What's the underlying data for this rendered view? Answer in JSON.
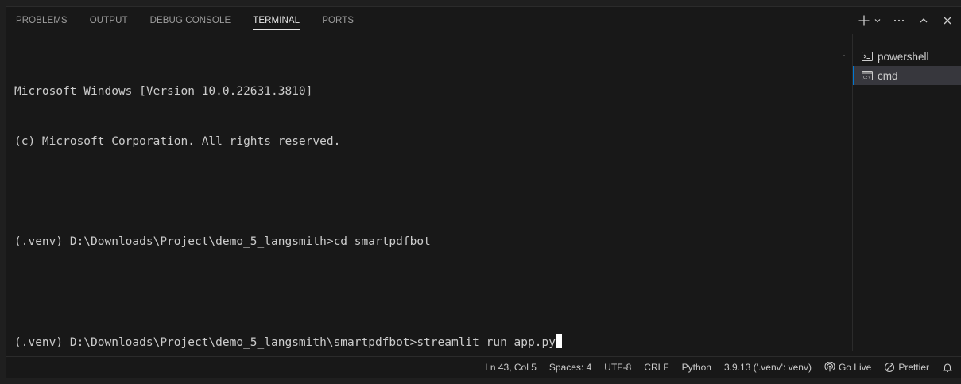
{
  "panel": {
    "tabs": [
      {
        "label": "PROBLEMS",
        "active": false
      },
      {
        "label": "OUTPUT",
        "active": false
      },
      {
        "label": "DEBUG CONSOLE",
        "active": false
      },
      {
        "label": "TERMINAL",
        "active": true
      },
      {
        "label": "PORTS",
        "active": false
      }
    ],
    "actions": [
      "plus-icon",
      "chevron-down-icon",
      "ellipsis-icon",
      "chevron-up-icon",
      "close-icon"
    ]
  },
  "terminal": {
    "lines": [
      "Microsoft Windows [Version 10.0.22631.3810]",
      "(c) Microsoft Corporation. All rights reserved.",
      "",
      "(.venv) D:\\Downloads\\Project\\demo_5_langsmith>cd smartpdfbot",
      "",
      "(.venv) D:\\Downloads\\Project\\demo_5_langsmith\\smartpdfbot>streamlit run app.py"
    ]
  },
  "terminal_list": {
    "items": [
      {
        "label": "powershell",
        "icon": "powershell-icon",
        "active": false
      },
      {
        "label": "cmd",
        "icon": "cmd-icon",
        "active": true
      }
    ]
  },
  "statusbar": {
    "position": "Ln 43, Col 5",
    "spaces": "Spaces: 4",
    "encoding": "UTF-8",
    "eol": "CRLF",
    "language": "Python",
    "interpreter": "3.9.13 ('.venv': venv)",
    "go_live": "Go Live",
    "prettier": "Prettier"
  },
  "colors": {
    "background": "#181818",
    "text": "#cccccc",
    "accent": "#0078d4"
  }
}
